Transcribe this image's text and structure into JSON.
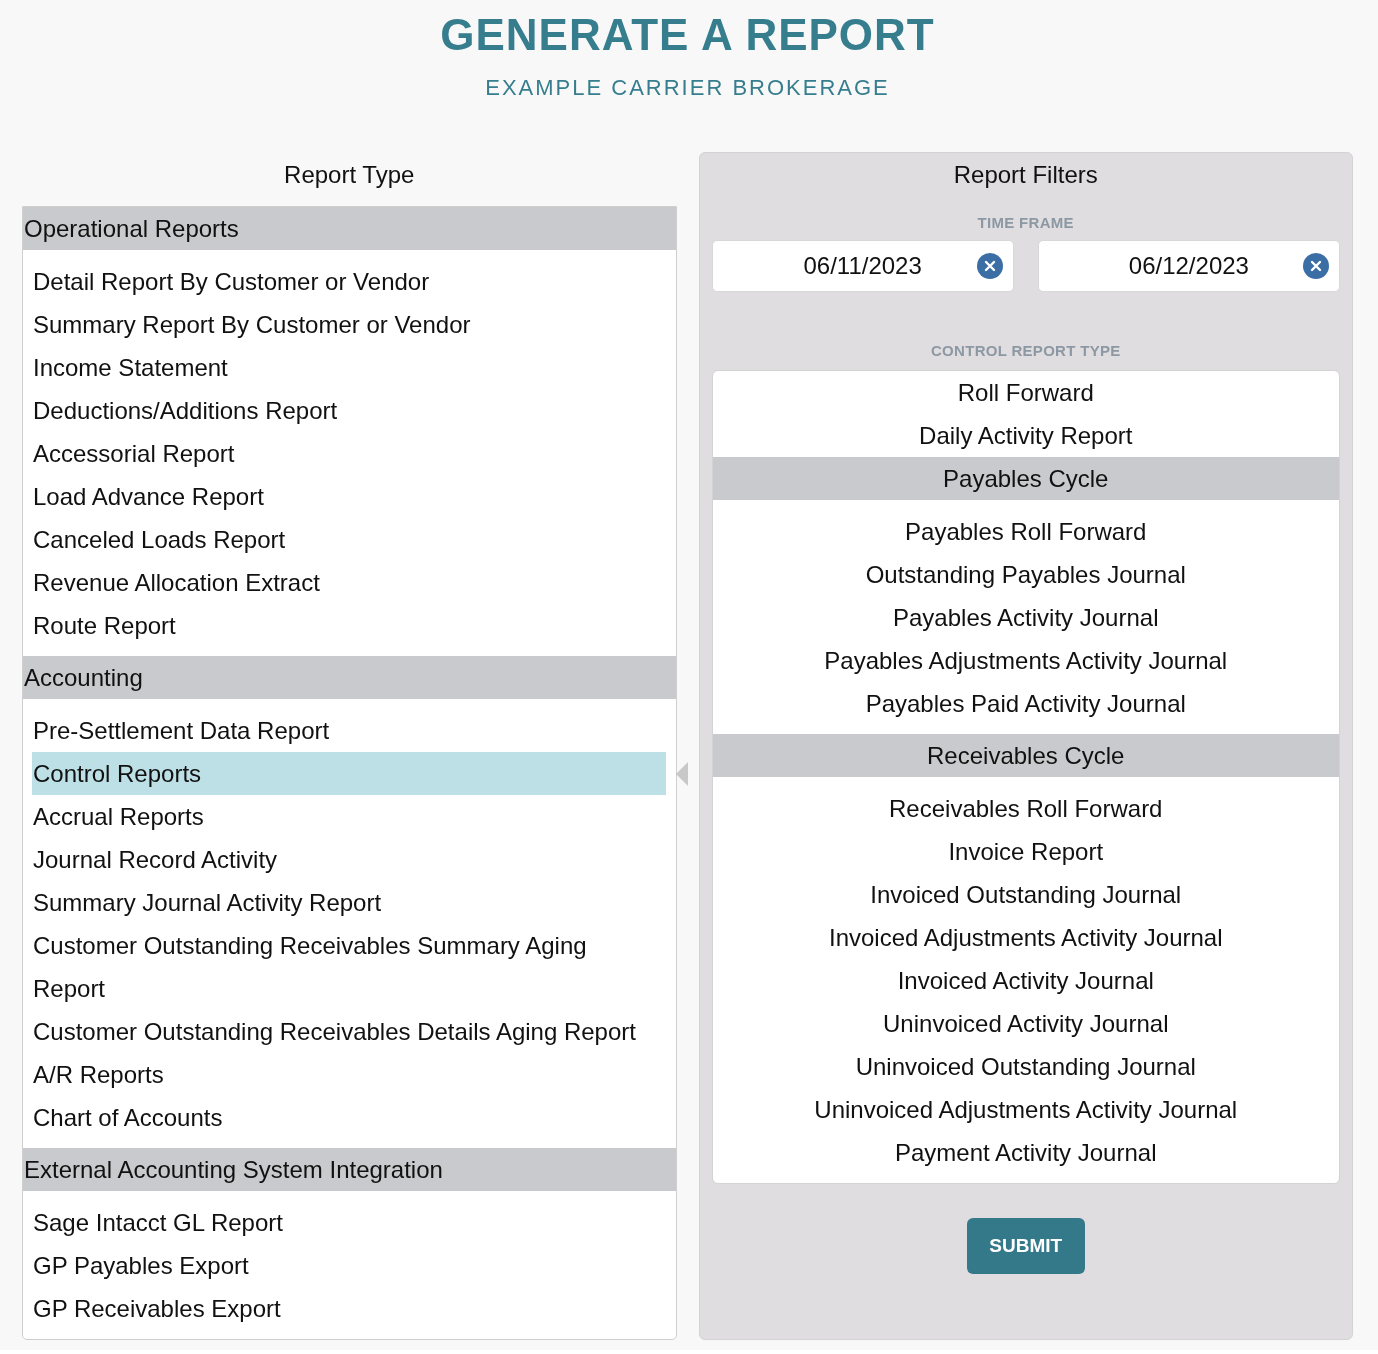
{
  "header": {
    "title": "GENERATE A REPORT",
    "subtitle": "EXAMPLE CARRIER BROKERAGE"
  },
  "report_type": {
    "heading": "Report Type",
    "groups": [
      {
        "title": "Operational Reports",
        "items": [
          {
            "label": "Detail Report By Customer or Vendor",
            "selected": false
          },
          {
            "label": "Summary Report By Customer or Vendor",
            "selected": false
          },
          {
            "label": "Income Statement",
            "selected": false
          },
          {
            "label": "Deductions/Additions Report",
            "selected": false
          },
          {
            "label": "Accessorial Report",
            "selected": false
          },
          {
            "label": "Load Advance Report",
            "selected": false
          },
          {
            "label": "Canceled Loads Report",
            "selected": false
          },
          {
            "label": "Revenue Allocation Extract",
            "selected": false
          },
          {
            "label": "Route Report",
            "selected": false
          }
        ]
      },
      {
        "title": "Accounting",
        "items": [
          {
            "label": "Pre-Settlement Data Report",
            "selected": false
          },
          {
            "label": "Control Reports",
            "selected": true
          },
          {
            "label": "Accrual Reports",
            "selected": false
          },
          {
            "label": "Journal Record Activity",
            "selected": false
          },
          {
            "label": "Summary Journal Activity Report",
            "selected": false
          },
          {
            "label": "Customer Outstanding Receivables Summary Aging Report",
            "selected": false
          },
          {
            "label": "Customer Outstanding Receivables Details Aging Report",
            "selected": false
          },
          {
            "label": "A/R Reports",
            "selected": false
          },
          {
            "label": "Chart of Accounts",
            "selected": false
          }
        ]
      },
      {
        "title": "External Accounting System Integration",
        "items": [
          {
            "label": "Sage Intacct GL Report",
            "selected": false
          },
          {
            "label": "GP Payables Export",
            "selected": false
          },
          {
            "label": "GP Receivables Export",
            "selected": false
          }
        ]
      }
    ]
  },
  "report_filters": {
    "heading": "Report Filters",
    "time_frame": {
      "label": "TIME FRAME",
      "fields": [
        {
          "value": "06/11/2023"
        },
        {
          "value": "06/12/2023"
        }
      ]
    },
    "control_report_type": {
      "label": "CONTROL REPORT TYPE",
      "groups": [
        {
          "items": [
            {
              "label": "Roll Forward",
              "selected": false
            },
            {
              "label": "Daily Activity Report",
              "selected": false
            }
          ]
        },
        {
          "title": "Payables Cycle",
          "items": [
            {
              "label": "Payables Roll Forward",
              "selected": false
            },
            {
              "label": "Outstanding Payables Journal",
              "selected": false
            },
            {
              "label": "Payables Activity Journal",
              "selected": false
            },
            {
              "label": "Payables Adjustments Activity Journal",
              "selected": false
            },
            {
              "label": "Payables Paid Activity Journal",
              "selected": false
            }
          ]
        },
        {
          "title": "Receivables Cycle",
          "items": [
            {
              "label": "Receivables Roll Forward",
              "selected": false
            },
            {
              "label": "Invoice Report",
              "selected": false
            },
            {
              "label": "Invoiced Outstanding Journal",
              "selected": false
            },
            {
              "label": "Invoiced Adjustments Activity Journal",
              "selected": false
            },
            {
              "label": "Invoiced Activity Journal",
              "selected": false
            },
            {
              "label": "Uninvoiced Activity Journal",
              "selected": false
            },
            {
              "label": "Uninvoiced Outstanding Journal",
              "selected": false
            },
            {
              "label": "Uninvoiced Adjustments Activity Journal",
              "selected": false
            },
            {
              "label": "Payment Activity Journal",
              "selected": false
            }
          ]
        }
      ]
    },
    "submit_button": "SUBMIT"
  }
}
